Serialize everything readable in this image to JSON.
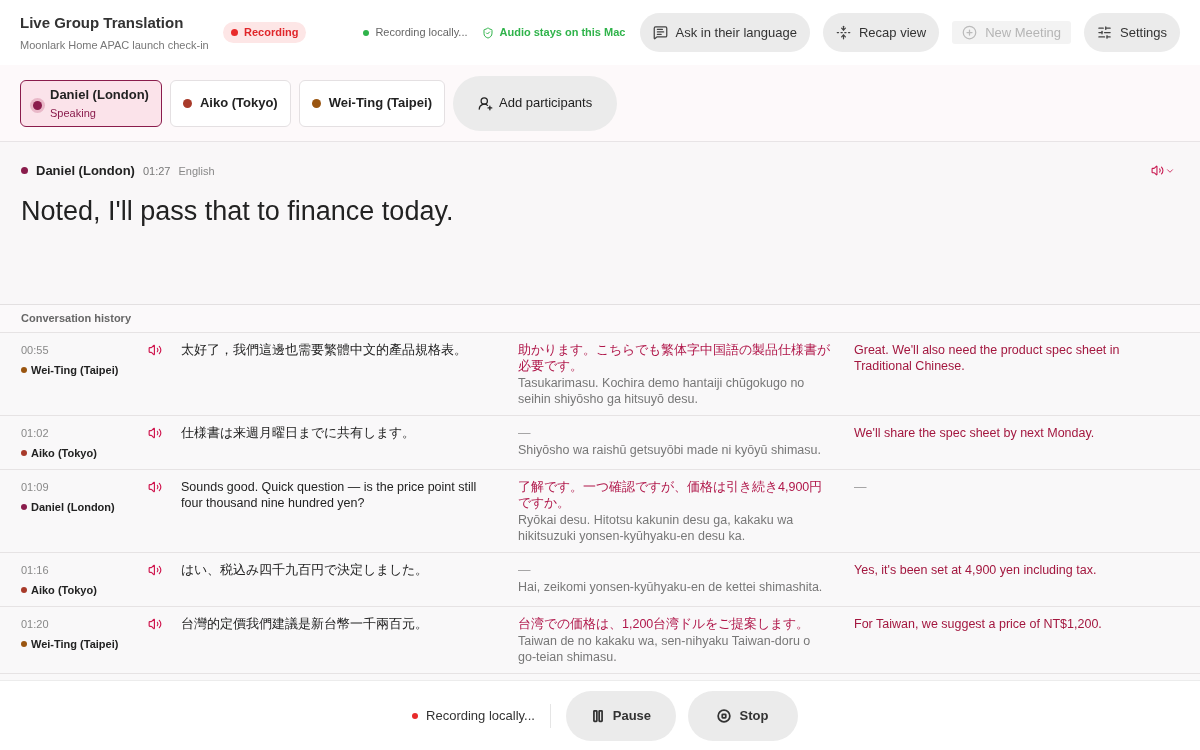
{
  "header": {
    "title": "Live Group Translation",
    "subtitle": "Moonlark Home APAC launch check-in",
    "recording_badge": "Recording",
    "status": "Recording locally...",
    "privacy": "Audio stays on this Mac"
  },
  "toolbar": [
    {
      "kind": "ask",
      "label": "Ask in their language",
      "disabled": false
    },
    {
      "kind": "recap",
      "label": "Recap view",
      "disabled": false
    },
    {
      "kind": "new",
      "label": "New Meeting",
      "disabled": true
    },
    {
      "kind": "settings",
      "label": "Settings",
      "disabled": false
    }
  ],
  "participants": [
    {
      "name": "Daniel (London)",
      "status": "Speaking",
      "selected": true,
      "color": "#8a1c4c"
    },
    {
      "name": "Aiko (Tokyo)",
      "selected": false,
      "color": "#a83a2a"
    },
    {
      "name": "Wei-Ting (Taipei)",
      "selected": false,
      "color": "#9a5510"
    }
  ],
  "add_participants": "Add participants",
  "current": {
    "speaker": "Daniel (London)",
    "color": "#8a1c4c",
    "time": "01:27",
    "language": "English",
    "text": "Noted, I'll pass that to finance today."
  },
  "history": {
    "title": "Conversation history",
    "rows": [
      {
        "time": "00:55",
        "speaker": "Wei-Ting (Taipei)",
        "color": "#9a5510",
        "original": "太好了，我們這邊也需要繁體中文的產品規格表。",
        "japanese": "助かります。こちらでも繁体字中国語の製品仕様書が必要です。",
        "romaji": "Tasukarimasu. Kochira demo hantaiji chūgokugo no seihin shiyōsho ga hitsuyō desu.",
        "english": "Great. We'll also need the product spec sheet in Traditional Chinese."
      },
      {
        "time": "01:02",
        "speaker": "Aiko (Tokyo)",
        "color": "#a83a2a",
        "original": "仕様書は来週月曜日までに共有します。",
        "japanese": "—",
        "romaji": "Shiyōsho wa raishū getsuyōbi made ni kyōyū shimasu.",
        "english": "We'll share the spec sheet by next Monday."
      },
      {
        "time": "01:09",
        "speaker": "Daniel (London)",
        "color": "#8a1c4c",
        "original": "Sounds good. Quick question — is the price point still four thousand nine hundred yen?",
        "japanese": "了解です。一つ確認ですが、価格は引き続き4,900円ですか。",
        "romaji": "Ryōkai desu. Hitotsu kakunin desu ga, kakaku wa hikitsuzuki yonsen-kyūhyaku-en desu ka.",
        "english": "—"
      },
      {
        "time": "01:16",
        "speaker": "Aiko (Tokyo)",
        "color": "#a83a2a",
        "original": "はい、税込み四千九百円で決定しました。",
        "japanese": "—",
        "romaji": "Hai, zeikomi yonsen-kyūhyaku-en de kettei shimashita.",
        "english": "Yes, it's been set at 4,900 yen including tax."
      },
      {
        "time": "01:20",
        "speaker": "Wei-Ting (Taipei)",
        "color": "#9a5510",
        "original": "台灣的定價我們建議是新台幣一千兩百元。",
        "japanese": "台湾での価格は、1,200台湾ドルをご提案します。",
        "romaji": "Taiwan de no kakaku wa, sen-nihyaku Taiwan-doru o go-teian shimasu.",
        "english": "For Taiwan, we suggest a price of NT$1,200."
      }
    ]
  },
  "footer": {
    "status": "Recording locally...",
    "buttons": [
      {
        "kind": "pause",
        "label": "Pause"
      },
      {
        "kind": "stop",
        "label": "Stop"
      }
    ]
  }
}
